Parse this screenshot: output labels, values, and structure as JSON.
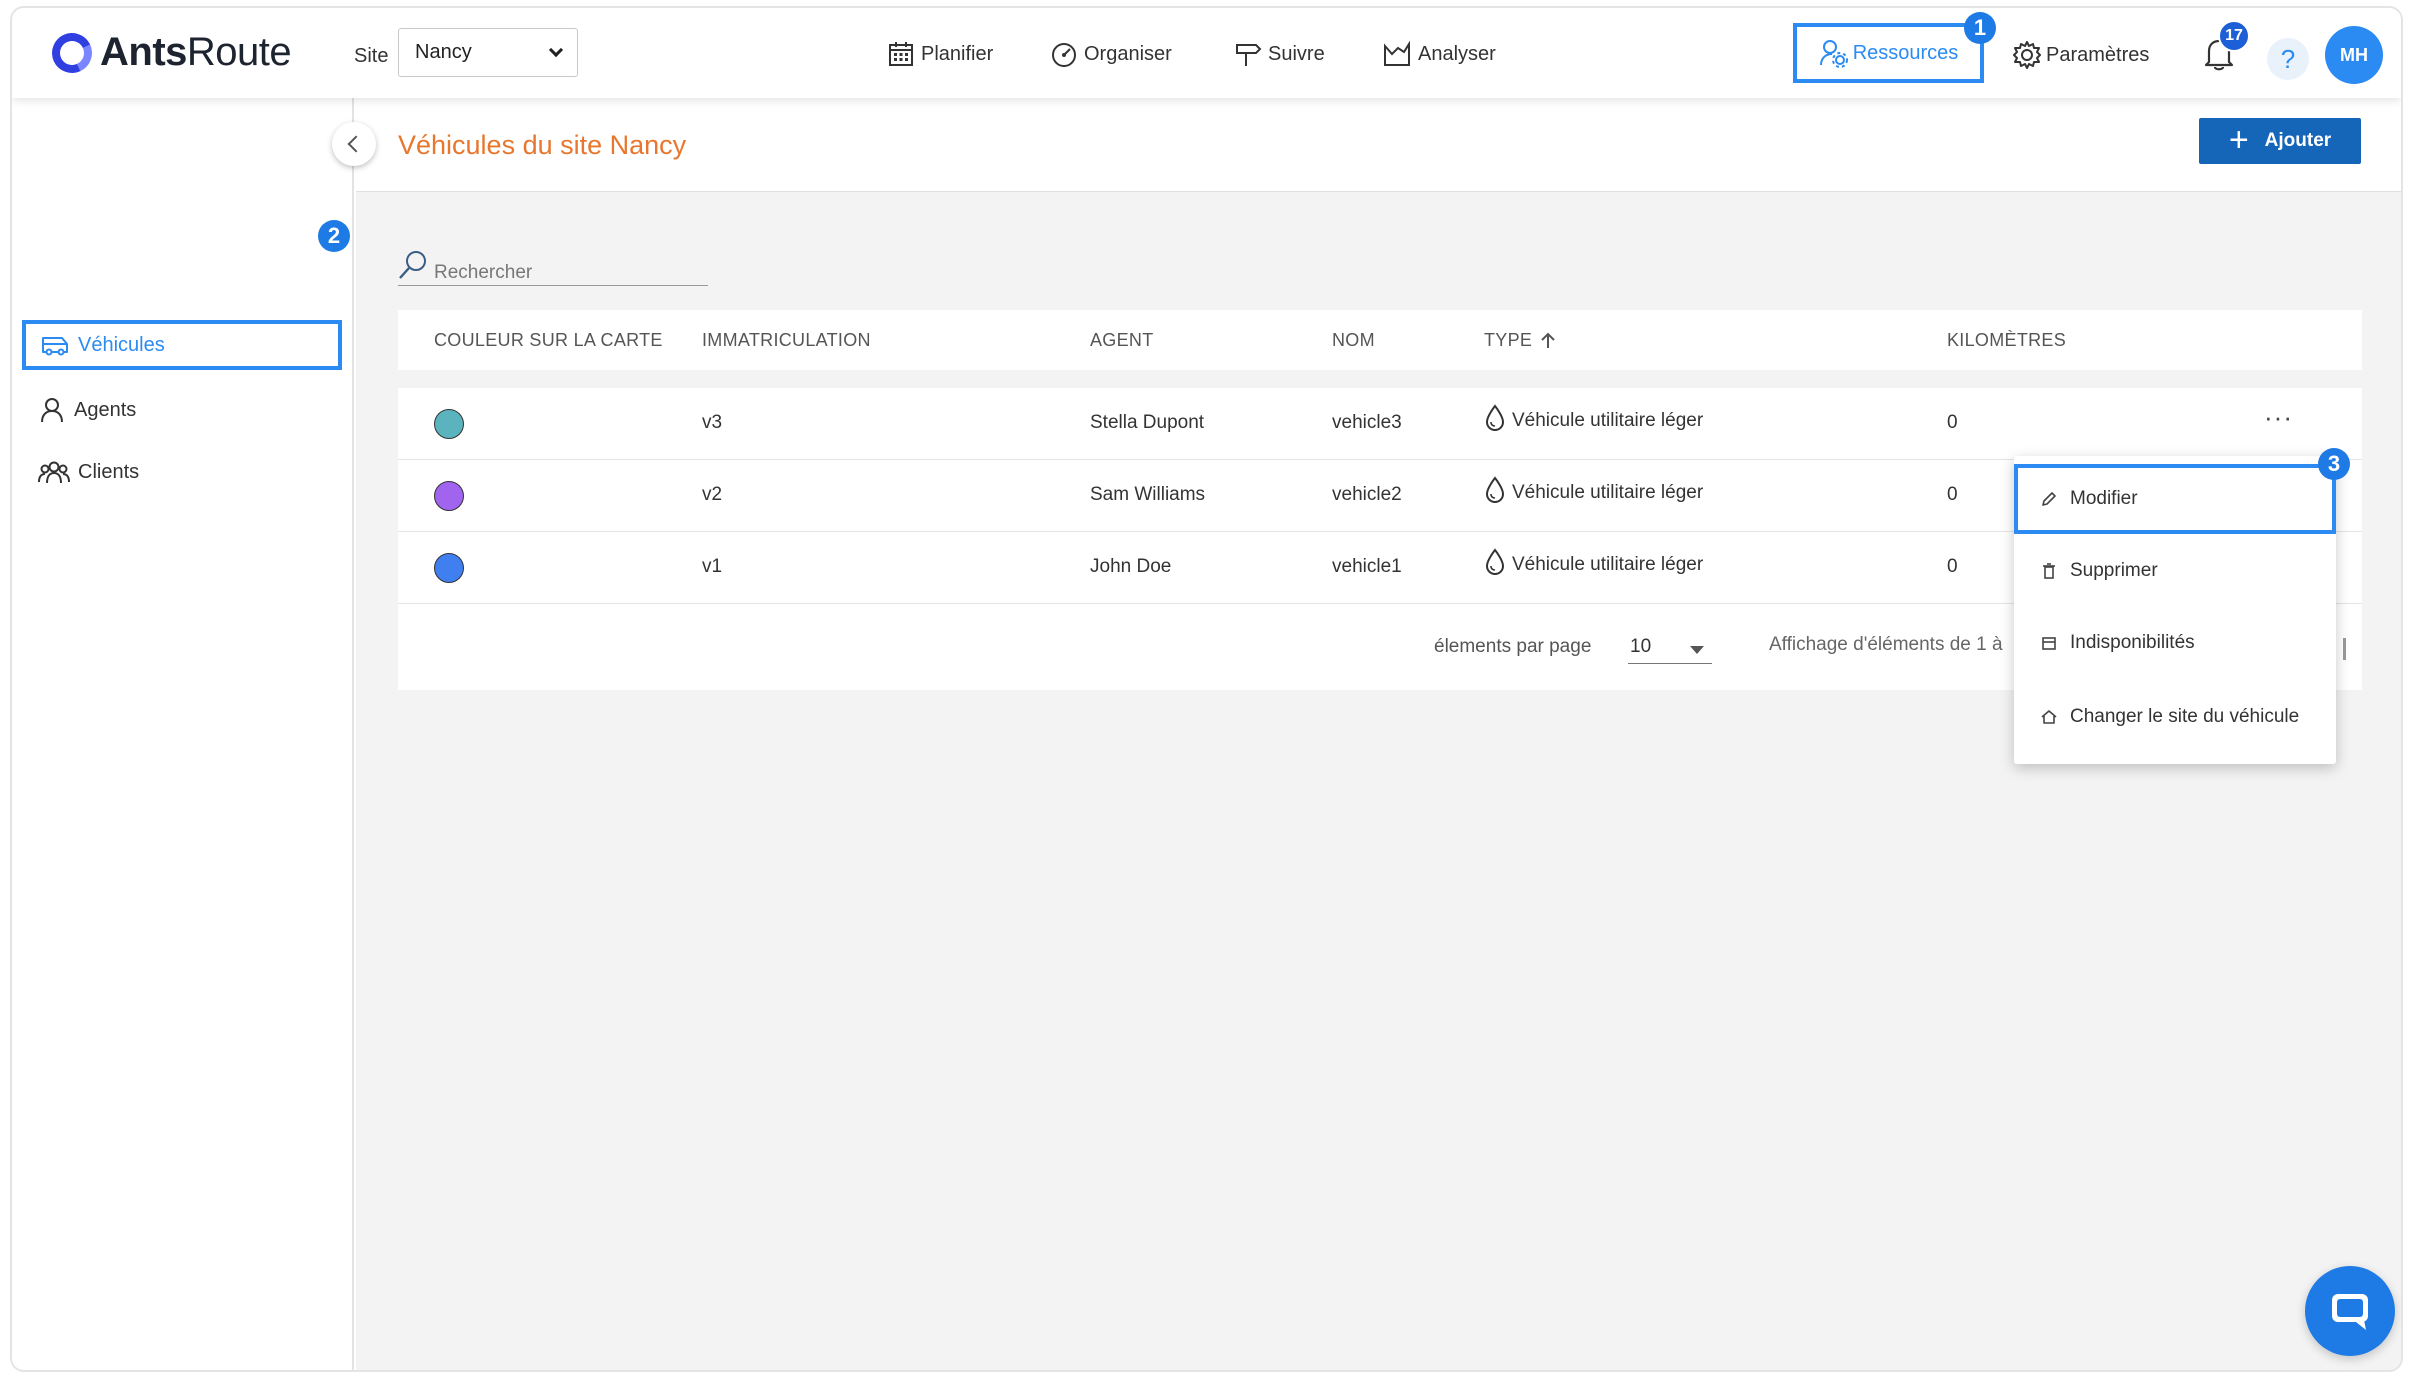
{
  "brand": {
    "name_bold": "Ants",
    "name_rest": "Route"
  },
  "site": {
    "label": "Site",
    "selected": "Nancy"
  },
  "nav": [
    {
      "label": "Planifier",
      "icon": "calendar-icon"
    },
    {
      "label": "Organiser",
      "icon": "gauge-icon"
    },
    {
      "label": "Suivre",
      "icon": "signpost-icon"
    },
    {
      "label": "Analyser",
      "icon": "chart-icon"
    }
  ],
  "header": {
    "resources_label": "Ressources",
    "settings_label": "Paramètres",
    "notifications_count": "17",
    "help_label": "?",
    "avatar_initials": "MH"
  },
  "callouts": {
    "one": "1",
    "two": "2",
    "three": "3"
  },
  "sidebar": {
    "items": [
      {
        "label": "Véhicules",
        "icon": "van-icon",
        "active": true
      },
      {
        "label": "Agents",
        "icon": "person-icon"
      },
      {
        "label": "Clients",
        "icon": "group-icon"
      }
    ]
  },
  "main": {
    "title": "Véhicules du site Nancy",
    "add_label": "Ajouter",
    "search_placeholder": "Rechercher",
    "columns": [
      "COULEUR SUR LA CARTE",
      "IMMATRICULATION",
      "AGENT",
      "NOM",
      "TYPE",
      "KILOMÈTRES"
    ],
    "rows": [
      {
        "color": "#5bb3bd",
        "plate": "v3",
        "agent": "Stella Dupont",
        "name": "vehicle3",
        "type": "Véhicule utilitaire léger",
        "km": "0"
      },
      {
        "color": "#a064ee",
        "plate": "v2",
        "agent": "Sam Williams",
        "name": "vehicle2",
        "type": "Véhicule utilitaire léger",
        "km": "0"
      },
      {
        "color": "#3f7ff0",
        "plate": "v1",
        "agent": "John Doe",
        "name": "vehicle1",
        "type": "Véhicule utilitaire léger",
        "km": "0"
      }
    ],
    "more_label": "···",
    "per_page_label": "élements par page",
    "per_page_value": "10",
    "showing_text": "Affichage d'éléments de 1 à"
  },
  "menu": {
    "items": [
      {
        "label": "Modifier",
        "icon": "pencil-icon"
      },
      {
        "label": "Supprimer",
        "icon": "trash-icon"
      },
      {
        "label": "Indisponibilités",
        "icon": "calendar-small-icon"
      },
      {
        "label": "Changer le site du véhicule",
        "icon": "home-icon"
      }
    ]
  },
  "colors": {
    "accent": "#2b8bf2",
    "title": "#e8772e",
    "primary_button": "#1565b8"
  }
}
